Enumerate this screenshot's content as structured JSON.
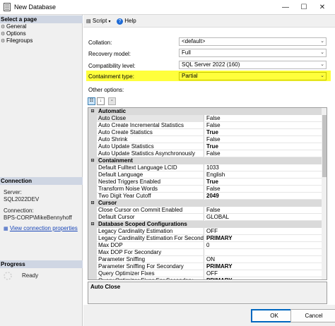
{
  "window": {
    "title": "New Database",
    "minimize_glyph": "—",
    "maximize_glyph": "☐",
    "close_glyph": "✕"
  },
  "left_panel": {
    "select_page_header": "Select a page",
    "pages": [
      "General",
      "Options",
      "Filegroups"
    ],
    "connection_header": "Connection",
    "server_label": "Server:",
    "server_value": "SQL2022DEV",
    "connection_label": "Connection:",
    "connection_value": "BPS-CORP\\MikeBennyhoff",
    "view_connection_properties": "View connection properties",
    "progress_header": "Progress",
    "progress_status": "Ready"
  },
  "toolbar": {
    "script_label": "Script",
    "help_label": "Help"
  },
  "form": {
    "collation_label": "Collation:",
    "collation_value": "<default>",
    "recovery_label": "Recovery model:",
    "recovery_value": "Full",
    "compat_label": "Compatibility level:",
    "compat_value": "SQL Server 2022 (160)",
    "containment_label": "Containment type:",
    "containment_value": "Partial",
    "other_options_label": "Other options:"
  },
  "property_grid": {
    "rows": [
      {
        "cat": true,
        "name": "Automatic"
      },
      {
        "name": "Auto Close",
        "value": "False",
        "selected": true
      },
      {
        "name": "Auto Create Incremental Statistics",
        "value": "False"
      },
      {
        "name": "Auto Create Statistics",
        "value": "True",
        "bold": true
      },
      {
        "name": "Auto Shrink",
        "value": "False"
      },
      {
        "name": "Auto Update Statistics",
        "value": "True",
        "bold": true
      },
      {
        "name": "Auto Update Statistics Asynchronously",
        "value": "False"
      },
      {
        "cat": true,
        "name": "Containment"
      },
      {
        "name": "Default Fulltext Language LCID",
        "value": "1033"
      },
      {
        "name": "Default Language",
        "value": "English"
      },
      {
        "name": "Nested Triggers Enabled",
        "value": "True",
        "bold": true
      },
      {
        "name": "Transform Noise Words",
        "value": "False"
      },
      {
        "name": "Two Digit Year Cutoff",
        "value": "2049",
        "bold": true
      },
      {
        "cat": true,
        "name": "Cursor"
      },
      {
        "name": "Close Cursor on Commit Enabled",
        "value": "False"
      },
      {
        "name": "Default Cursor",
        "value": "GLOBAL"
      },
      {
        "cat": true,
        "name": "Database Scoped Configurations"
      },
      {
        "name": "Legacy Cardinality Estimation",
        "value": "OFF"
      },
      {
        "name": "Legacy Cardinality Estimation For Secondary",
        "value": "PRIMARY",
        "bold": true
      },
      {
        "name": "Max DOP",
        "value": "0"
      },
      {
        "name": "Max DOP For Secondary",
        "value": ""
      },
      {
        "name": "Parameter Sniffing",
        "value": "ON"
      },
      {
        "name": "Parameter Sniffing For Secondary",
        "value": "PRIMARY",
        "bold": true
      },
      {
        "name": "Query Optimizer Fixes",
        "value": "OFF"
      },
      {
        "name": "Query Optimizer Fixes For Secondary",
        "value": "PRIMARY",
        "bold": true
      }
    ]
  },
  "description": {
    "title": "Auto Close"
  },
  "buttons": {
    "ok": "OK",
    "cancel": "Cancel"
  },
  "colors": {
    "highlight": "#ffff3c",
    "section_header": "#cfd6e3",
    "link": "#1a47b8",
    "default_button_border": "#0067c0"
  }
}
